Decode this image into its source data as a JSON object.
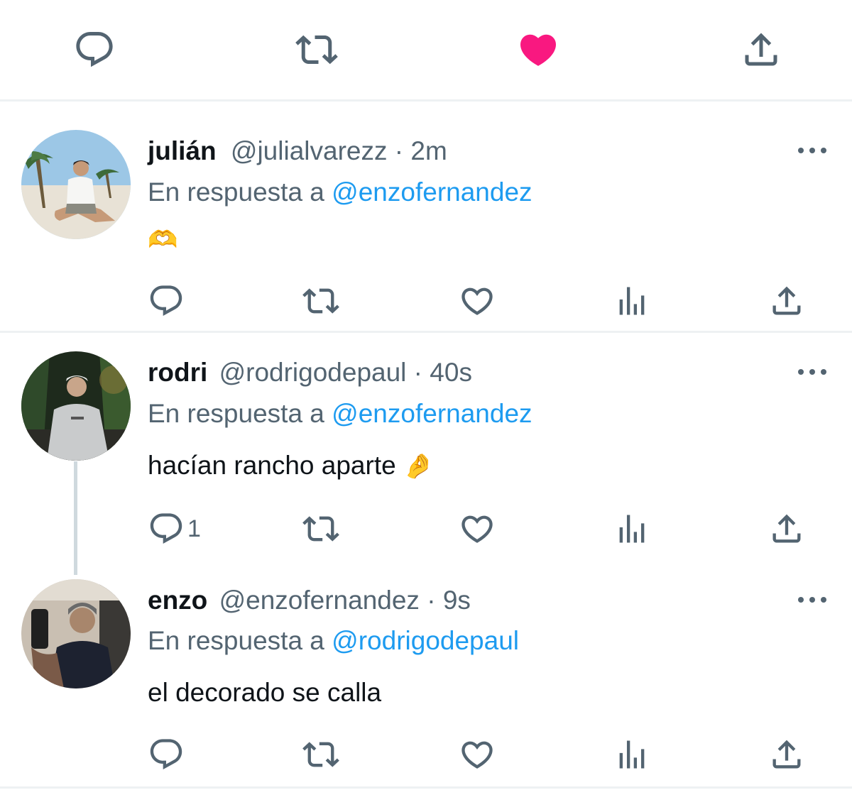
{
  "top_actions": {
    "icons": [
      "reply-icon",
      "retweet-icon",
      "like-icon-filled",
      "share-icon"
    ],
    "like_color": "#f91880"
  },
  "colors": {
    "text": "#0f1419",
    "muted": "#536471",
    "accent": "#1d9bf0"
  },
  "tweets": [
    {
      "name": "julián",
      "handle": "@julialvarezz",
      "time": "2m",
      "reply_prefix": "En respuesta a",
      "reply_to": "@enzofernandez",
      "text": "",
      "emoji": "🫶",
      "reply_count": ""
    },
    {
      "name": "rodri",
      "handle": "@rodrigodepaul",
      "time": "40s",
      "reply_prefix": "En respuesta a",
      "reply_to": "@enzofernandez",
      "text": "hacían rancho aparte",
      "emoji": "🤌",
      "reply_count": "1"
    },
    {
      "name": "enzo",
      "handle": "@enzofernandez",
      "time": "9s",
      "reply_prefix": "En respuesta a",
      "reply_to": "@rodrigodepaul",
      "text": "el decorado se calla",
      "emoji": "",
      "reply_count": ""
    }
  ],
  "separator": " · "
}
